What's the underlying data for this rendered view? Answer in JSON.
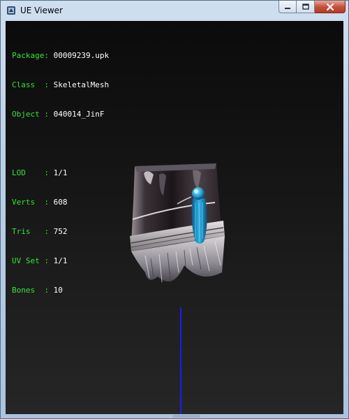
{
  "window": {
    "title": "UE Viewer"
  },
  "caption_buttons": {
    "minimize_icon": "minimize-icon",
    "maximize_icon": "maximize-icon",
    "close_icon": "close-icon"
  },
  "info": {
    "package_label": "Package",
    "package_value": "00009239.upk",
    "class_label": "Class",
    "class_value": "SkeletalMesh",
    "object_label": "Object",
    "object_value": "040014_JinF",
    "lod_label": "LOD",
    "lod_value": "1/1",
    "verts_label": "Verts",
    "verts_value": "608",
    "tris_label": "Tris",
    "tris_value": "752",
    "uvset_label": "UV Set",
    "uvset_value": "1/1",
    "bones_label": "Bones",
    "bones_value": "10"
  },
  "colors": {
    "label_green": "#33e533",
    "value_white": "#ffffff",
    "axis_blue": "#1a1aff"
  }
}
